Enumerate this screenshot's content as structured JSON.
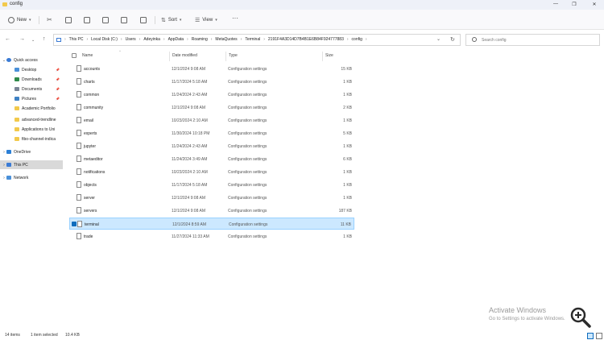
{
  "window": {
    "title": "config"
  },
  "toolbar": {
    "new_label": "New",
    "sort_label": "Sort",
    "view_label": "View",
    "more_label": "···"
  },
  "address": {
    "crumbs": [
      "This PC",
      "Local Disk (C:)",
      "Users",
      "Adeyinka",
      "AppData",
      "Roaming",
      "MetaQuotes",
      "Terminal",
      "2191F4A3D14D7B4B1E6B84F924777883",
      "config"
    ],
    "search_placeholder": "Search config"
  },
  "nav": {
    "items": [
      {
        "label": "Quick access",
        "pinned": false
      },
      {
        "label": "Desktop",
        "pinned": true
      },
      {
        "label": "Downloads",
        "pinned": true
      },
      {
        "label": "Documents",
        "pinned": true
      },
      {
        "label": "Pictures",
        "pinned": true
      },
      {
        "label": "Academic Portfolio",
        "pinned": false
      },
      {
        "label": "advanced-trendline",
        "pinned": false
      },
      {
        "label": "Applications to Uni",
        "pinned": false
      },
      {
        "label": "fibo-channel-indica",
        "pinned": false
      },
      {
        "label": "OneDrive",
        "pinned": false
      },
      {
        "label": "This PC",
        "pinned": false
      },
      {
        "label": "Network",
        "pinned": false
      }
    ]
  },
  "columns": {
    "name": "Name",
    "date": "Date modified",
    "type": "Type",
    "size": "Size"
  },
  "files": [
    {
      "name": "accounts",
      "date": "12/1/2024 9:08 AM",
      "type": "Configuration settings",
      "size": "15 KB"
    },
    {
      "name": "charts",
      "date": "11/17/2024 5:18 AM",
      "type": "Configuration settings",
      "size": "1 KB"
    },
    {
      "name": "common",
      "date": "11/24/2024 2:43 AM",
      "type": "Configuration settings",
      "size": "1 KB"
    },
    {
      "name": "community",
      "date": "12/1/2024 9:08 AM",
      "type": "Configuration settings",
      "size": "2 KB"
    },
    {
      "name": "email",
      "date": "10/23/2024 2:10 AM",
      "type": "Configuration settings",
      "size": "1 KB"
    },
    {
      "name": "experts",
      "date": "11/30/2024 10:18 PM",
      "type": "Configuration settings",
      "size": "5 KB"
    },
    {
      "name": "jupyter",
      "date": "11/24/2024 2:43 AM",
      "type": "Configuration settings",
      "size": "1 KB"
    },
    {
      "name": "metaeditor",
      "date": "11/24/2024 3:49 AM",
      "type": "Configuration settings",
      "size": "6 KB"
    },
    {
      "name": "notifications",
      "date": "10/23/2024 2:10 AM",
      "type": "Configuration settings",
      "size": "1 KB"
    },
    {
      "name": "objects",
      "date": "11/17/2024 5:18 AM",
      "type": "Configuration settings",
      "size": "1 KB"
    },
    {
      "name": "server",
      "date": "12/1/2024 9:08 AM",
      "type": "Configuration settings",
      "size": "1 KB"
    },
    {
      "name": "servers",
      "date": "12/1/2024 9:08 AM",
      "type": "Configuration settings",
      "size": "187 KB"
    },
    {
      "name": "terminal",
      "date": "12/1/2024 8:59 AM",
      "type": "Configuration settings",
      "size": "11 KB"
    },
    {
      "name": "trade",
      "date": "11/27/2024 11:33 AM",
      "type": "Configuration settings",
      "size": "1 KB"
    }
  ],
  "selected_file_index": 12,
  "watermark": {
    "line1": "Activate Windows",
    "line2": "Go to Settings to activate Windows."
  },
  "status": {
    "count": "14 items",
    "selection": "1 item selected",
    "size": "10.4 KB"
  },
  "colors": {
    "accent": "#0f6cbd",
    "selection_bg": "#cce8ff",
    "folder": "#f2c94c"
  }
}
